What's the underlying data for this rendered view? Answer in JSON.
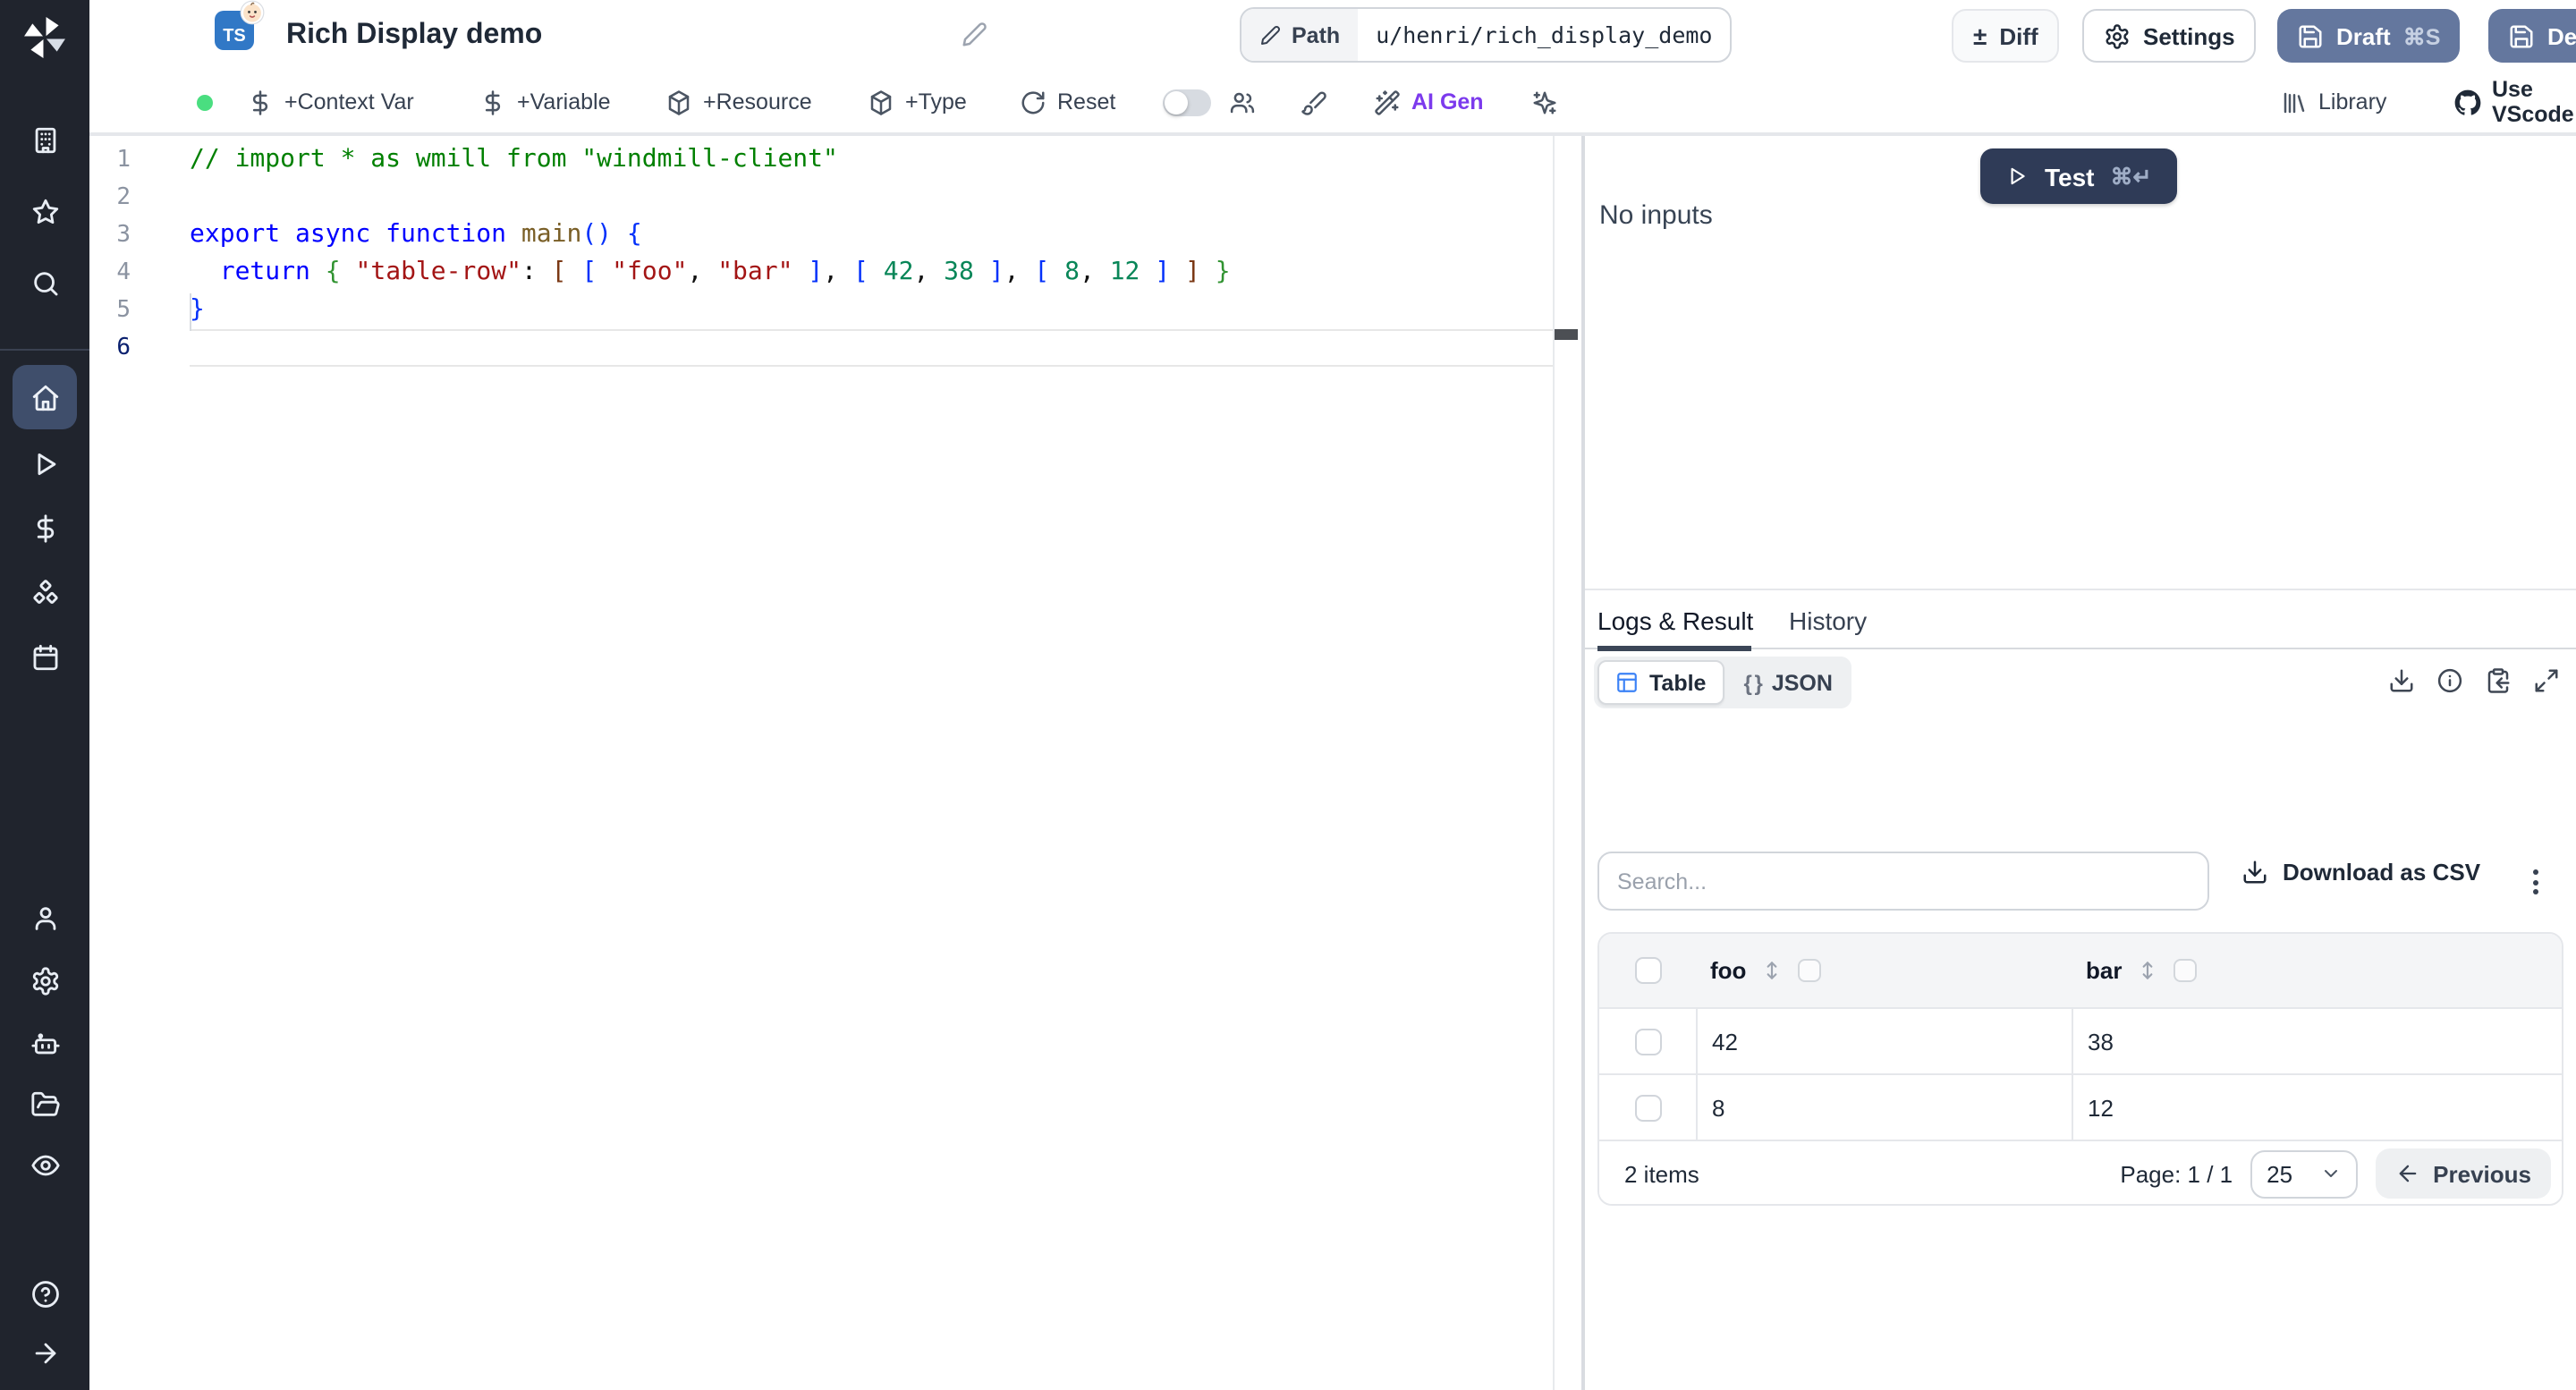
{
  "colors": {
    "brand_dark_button": "#2f3b57",
    "slate_button": "#64779e",
    "ai_accent": "#7c3aed",
    "status_green": "#4ade80",
    "ts_badge_blue": "#3178c6",
    "table_icon_blue": "#3b82f6",
    "sidebar_bg": "#20242d",
    "sidebar_active_bg": "#3f4e6b"
  },
  "sidebar": {
    "logo": "windmill-logo",
    "items_top": [
      "workspace",
      "favorites",
      "search"
    ],
    "items_main": [
      "home",
      "runs",
      "variables",
      "resources",
      "schedules"
    ],
    "active_item": "home",
    "items_bottom": [
      "account",
      "settings",
      "workers",
      "folders",
      "audit-logs"
    ],
    "items_footer": [
      "help",
      "expand-sidebar"
    ]
  },
  "header": {
    "language_badge": "TS",
    "title": "Rich Display demo",
    "path_label": "Path",
    "path_value": "u/henri/rich_display_demo",
    "diff_label": "Diff",
    "diff_glyph": "±",
    "settings_label": "Settings",
    "draft_label": "Draft",
    "draft_shortcut": "⌘S",
    "deploy_label": "Deploy"
  },
  "toolbar": {
    "context_var_label": "+Context Var",
    "variable_label": "+Variable",
    "resource_label": "+Resource",
    "type_label": "+Type",
    "reset_label": "Reset",
    "ai_gen_label": "AI Gen",
    "library_label": "Library",
    "use_vscode_label": "Use VScode"
  },
  "editor": {
    "language": "typescript",
    "lines": [
      {
        "n": "1",
        "segments": [
          {
            "t": "// import * as wmill from \"windmill-client\"",
            "c": "comment"
          }
        ]
      },
      {
        "n": "2",
        "segments": []
      },
      {
        "n": "3",
        "segments": [
          {
            "t": "export async function ",
            "c": "keyword"
          },
          {
            "t": "main",
            "c": "func"
          },
          {
            "t": "() {",
            "c": "b1"
          }
        ]
      },
      {
        "n": "4",
        "segments": [
          {
            "t": "  "
          },
          {
            "t": "return",
            "c": "keyword"
          },
          {
            "t": " "
          },
          {
            "t": "{",
            "c": "b2"
          },
          {
            "t": " "
          },
          {
            "t": "\"table-row\"",
            "c": "string"
          },
          {
            "t": ": "
          },
          {
            "t": "[",
            "c": "b3"
          },
          {
            "t": " "
          },
          {
            "t": "[",
            "c": "b1"
          },
          {
            "t": " "
          },
          {
            "t": "\"foo\"",
            "c": "string"
          },
          {
            "t": ", "
          },
          {
            "t": "\"bar\"",
            "c": "string"
          },
          {
            "t": " "
          },
          {
            "t": "]",
            "c": "b1"
          },
          {
            "t": ", "
          },
          {
            "t": "[",
            "c": "b1"
          },
          {
            "t": " "
          },
          {
            "t": "42",
            "c": "number"
          },
          {
            "t": ", "
          },
          {
            "t": "38",
            "c": "number"
          },
          {
            "t": " "
          },
          {
            "t": "]",
            "c": "b1"
          },
          {
            "t": ", "
          },
          {
            "t": "[",
            "c": "b1"
          },
          {
            "t": " "
          },
          {
            "t": "8",
            "c": "number"
          },
          {
            "t": ", "
          },
          {
            "t": "12",
            "c": "number"
          },
          {
            "t": " "
          },
          {
            "t": "]",
            "c": "b1"
          },
          {
            "t": " "
          },
          {
            "t": "]",
            "c": "b3"
          },
          {
            "t": " "
          },
          {
            "t": "}",
            "c": "b2"
          }
        ]
      },
      {
        "n": "5",
        "segments": [
          {
            "t": "}",
            "c": "b1"
          }
        ]
      },
      {
        "n": "6",
        "segments": [],
        "active": true
      }
    ]
  },
  "run_panel": {
    "test_label": "Test",
    "test_shortcut": "⌘↵",
    "no_inputs": "No inputs"
  },
  "result_panel": {
    "tabs": [
      {
        "label": "Logs & Result",
        "active": true
      },
      {
        "label": "History",
        "active": false
      }
    ],
    "view_toggle": [
      {
        "label": "Table",
        "active": true
      },
      {
        "label": "JSON",
        "active": false,
        "glyph": "{ }"
      }
    ],
    "action_icons": [
      "download",
      "info",
      "copy-to-clipboard",
      "expand"
    ],
    "search_placeholder": "Search...",
    "download_csv_label": "Download as CSV",
    "table": {
      "columns": [
        "foo",
        "bar"
      ],
      "rows": [
        [
          "42",
          "38"
        ],
        [
          "8",
          "12"
        ]
      ],
      "items_count": "2 items",
      "page_label": "Page: 1 / 1",
      "page_size": "25",
      "previous_label": "Previous"
    }
  }
}
